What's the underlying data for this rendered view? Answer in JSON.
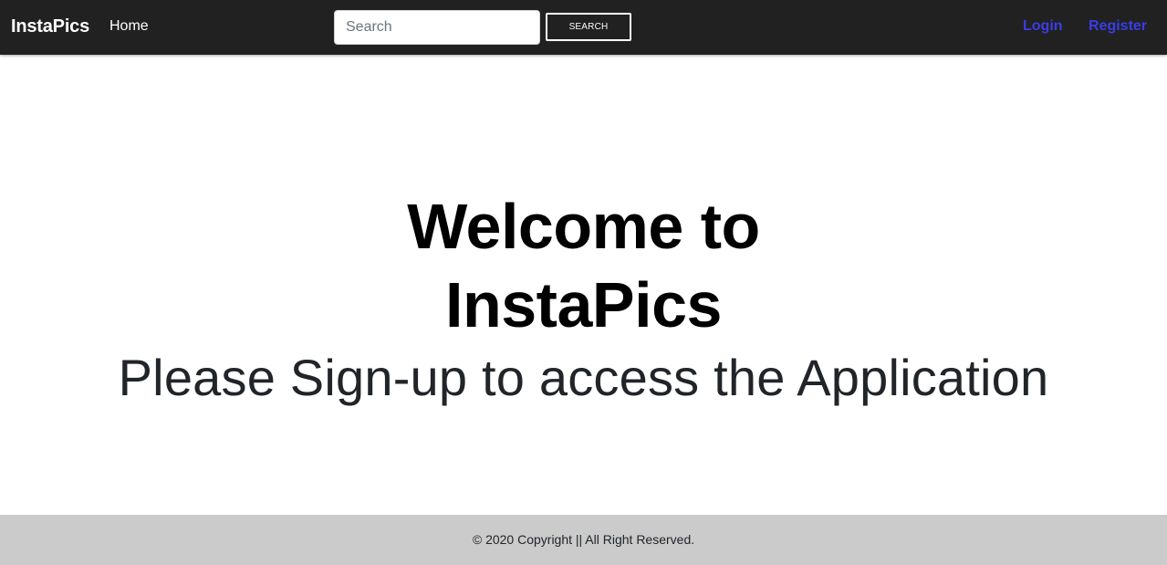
{
  "navbar": {
    "brand": "InstaPics",
    "home_label": "Home",
    "search": {
      "placeholder": "Search",
      "value": "",
      "button_label": "SEARCH"
    },
    "login_label": "Login",
    "register_label": "Register"
  },
  "hero": {
    "title_line1": "Welcome to",
    "title_line2": "InstaPics",
    "subtitle": "Please Sign-up to access the Application"
  },
  "footer": {
    "text": "© 2020 Copyright || All Right Reserved."
  },
  "colors": {
    "navbar_bg": "#212121",
    "link_accent": "#3a3de8",
    "footer_bg": "#cbcbcb"
  }
}
